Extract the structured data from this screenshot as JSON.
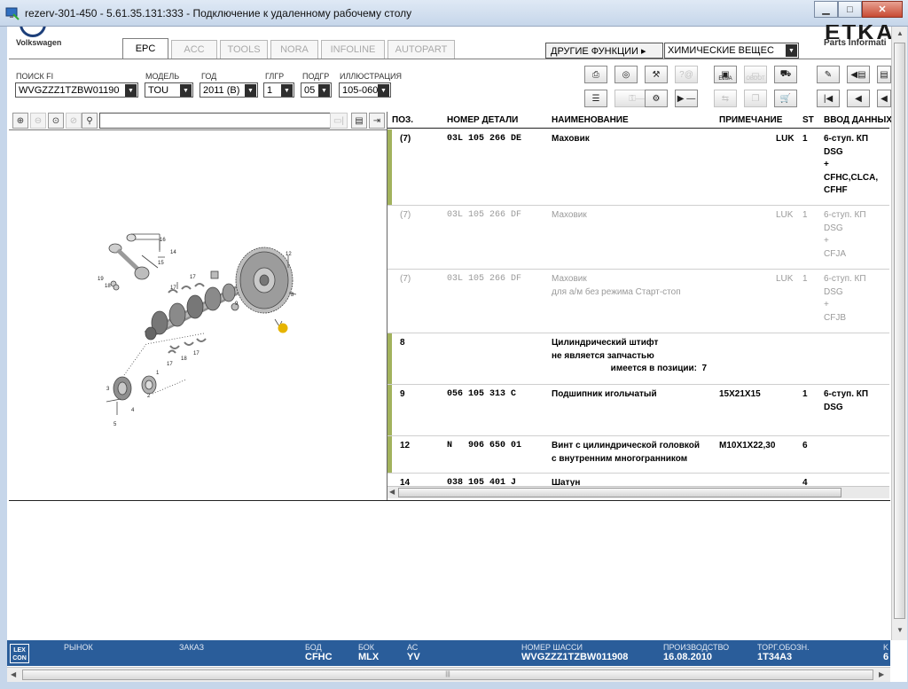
{
  "window": {
    "title": "rezerv-301-450 - 5.61.35.131:333 - Подключение к удаленному рабочему столу"
  },
  "app": {
    "brand": "Volkswagen",
    "logo_text": "ETKA",
    "logo_sub": "Parts Informati"
  },
  "tabs": [
    {
      "label": "EPC",
      "active": true,
      "width": 52
    },
    {
      "label": "ACC",
      "active": false,
      "width": 52
    },
    {
      "label": "TOOLS",
      "active": false,
      "width": 54
    },
    {
      "label": "NORA",
      "active": false,
      "width": 54
    },
    {
      "label": "INFOLINE",
      "active": false,
      "width": 72
    },
    {
      "label": "AUTOPART",
      "active": false,
      "width": 76
    }
  ],
  "functions": {
    "other_label": "ДРУГИЕ ФУНКЦИИ ▸",
    "chemicals": "ХИМИЧЕСКИЕ ВЕЩЕС"
  },
  "filters": {
    "search_label": "ПОИСК FI",
    "search_value": "WVGZZZ1TZBW01190",
    "model_label": "МОДЕЛЬ",
    "model_value": "TOU",
    "year_label": "ГОД",
    "year_value": "2011 (B)",
    "mg_label": "ГЛГР",
    "mg_value": "1",
    "sg_label": "ПОДГР",
    "sg_value": "05",
    "ill_label": "ИЛЛЮСТРАЦИЯ",
    "ill_value": "105-060"
  },
  "toolbar": {
    "elsa": "ELSA",
    "obdot": "OBDOT"
  },
  "table": {
    "headers": {
      "pos": "ПОЗ.",
      "part": "НОМЕР ДЕТАЛИ",
      "name": "НАИМЕНОВАНИЕ",
      "note": "ПРИМЕЧАНИЕ",
      "qty": "ST",
      "input": "ВВОД ДАННЫХ"
    },
    "rows": [
      {
        "pos": "(7)",
        "part": "03L 105 266 DE",
        "name": "Маховик",
        "note": "LUK",
        "qty": "1",
        "input": "6-ступ. КП\nDSG\n+\nCFHC,CLCA,\nCFHF",
        "grey": false,
        "bar": true
      },
      {
        "pos": "(7)",
        "part": "03L 105 266 DF",
        "name": "Маховик",
        "note": "LUK",
        "qty": "1",
        "input": "6-ступ. КП\nDSG\n+\nCFJA",
        "grey": true,
        "bar": false
      },
      {
        "pos": "(7)",
        "part": "03L 105 266 DF",
        "name": "Маховик\nдля а/м без режима Старт-стоп",
        "note": "LUK",
        "qty": "1",
        "input": "6-ступ. КП\nDSG\n+\nCFJB",
        "grey": true,
        "bar": false
      },
      {
        "pos": "8",
        "part": "",
        "name": "Цилиндрический штифт\nне является запчастью\n                        имеется в позиции:  7",
        "note": "",
        "qty": "",
        "input": "",
        "grey": false,
        "bar": true
      },
      {
        "pos": "9",
        "part": "056 105 313 C",
        "name": "Подшипник игольчатый",
        "note": "15X21X15",
        "qty": "1",
        "input": "6-ступ. КП\nDSG",
        "grey": false,
        "bar": true
      },
      {
        "pos": "12",
        "part": "N   906 650 01",
        "name": "Винт с цилиндрической головкой\nс внутренним многогранником",
        "note": "M10X1X22,30",
        "qty": "6",
        "input": "",
        "grey": false,
        "bar": true
      },
      {
        "pos": "14",
        "part": "038 105 401 J",
        "name": "Шатун",
        "note": "",
        "qty": "4",
        "input": "",
        "grey": false,
        "bar": false
      }
    ]
  },
  "diagram": {
    "labels": [
      "16",
      "14",
      "15",
      "19",
      "18",
      "17",
      "17",
      "9",
      "12",
      "8",
      "7",
      "18",
      "17",
      "17",
      "3",
      "4",
      "5",
      "2",
      "1"
    ]
  },
  "status": {
    "lex1": "LEX",
    "lex2": "CON",
    "market_label": "РЫНОК",
    "order_label": "ЗАКАЗ",
    "bod_label": "БОД",
    "bod_value": "CFHC",
    "bok_label": "БОК",
    "bok_value": "MLX",
    "ac_label": "АС",
    "ac_value": "YV",
    "chassis_label": "НОМЕР ШАССИ",
    "chassis_value": "WVGZZZ1TZBW011908",
    "prod_label": "ПРОИЗВОДСТВО",
    "prod_value": "16.08.2010",
    "trade_label": "ТОРГ.ОБОЗН.",
    "trade_value": "1T34A3",
    "extra_label": "K",
    "extra_value": "6"
  }
}
